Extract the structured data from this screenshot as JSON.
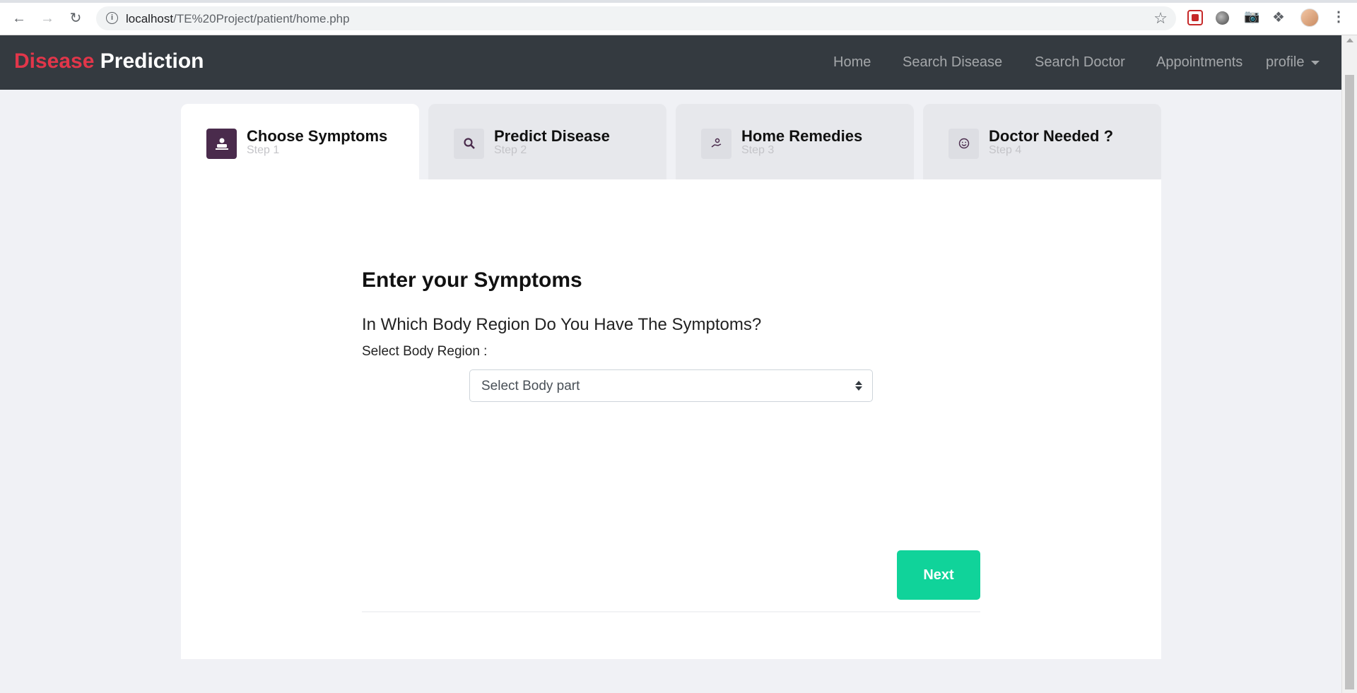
{
  "browser": {
    "url_host": "localhost",
    "url_path": "/TE%20Project/patient/home.php"
  },
  "navbar": {
    "brand_part1": "Disease",
    "brand_part2": "Prediction",
    "links": [
      "Home",
      "Search Disease",
      "Search Doctor",
      "Appointments"
    ],
    "profile_label": "profile"
  },
  "steps": [
    {
      "title": "Choose Symptoms",
      "sub": "Step 1",
      "icon": "patient-bed-icon"
    },
    {
      "title": "Predict Disease",
      "sub": "Step 2",
      "icon": "search-icon"
    },
    {
      "title": "Home Remedies",
      "sub": "Step 3",
      "icon": "hand-care-icon"
    },
    {
      "title": "Doctor Needed ?",
      "sub": "Step 4",
      "icon": "smile-icon"
    }
  ],
  "form": {
    "heading": "Enter your Symptoms",
    "question": "In Which Body Region Do You Have The Symptoms?",
    "select_label": "Select Body Region :",
    "select_value": "Select Body part",
    "next_label": "Next"
  },
  "colors": {
    "navbar_bg": "#343a40",
    "brand_red": "#e2364a",
    "step_active_icon": "#4a2b4c",
    "next_button": "#10d39a"
  }
}
